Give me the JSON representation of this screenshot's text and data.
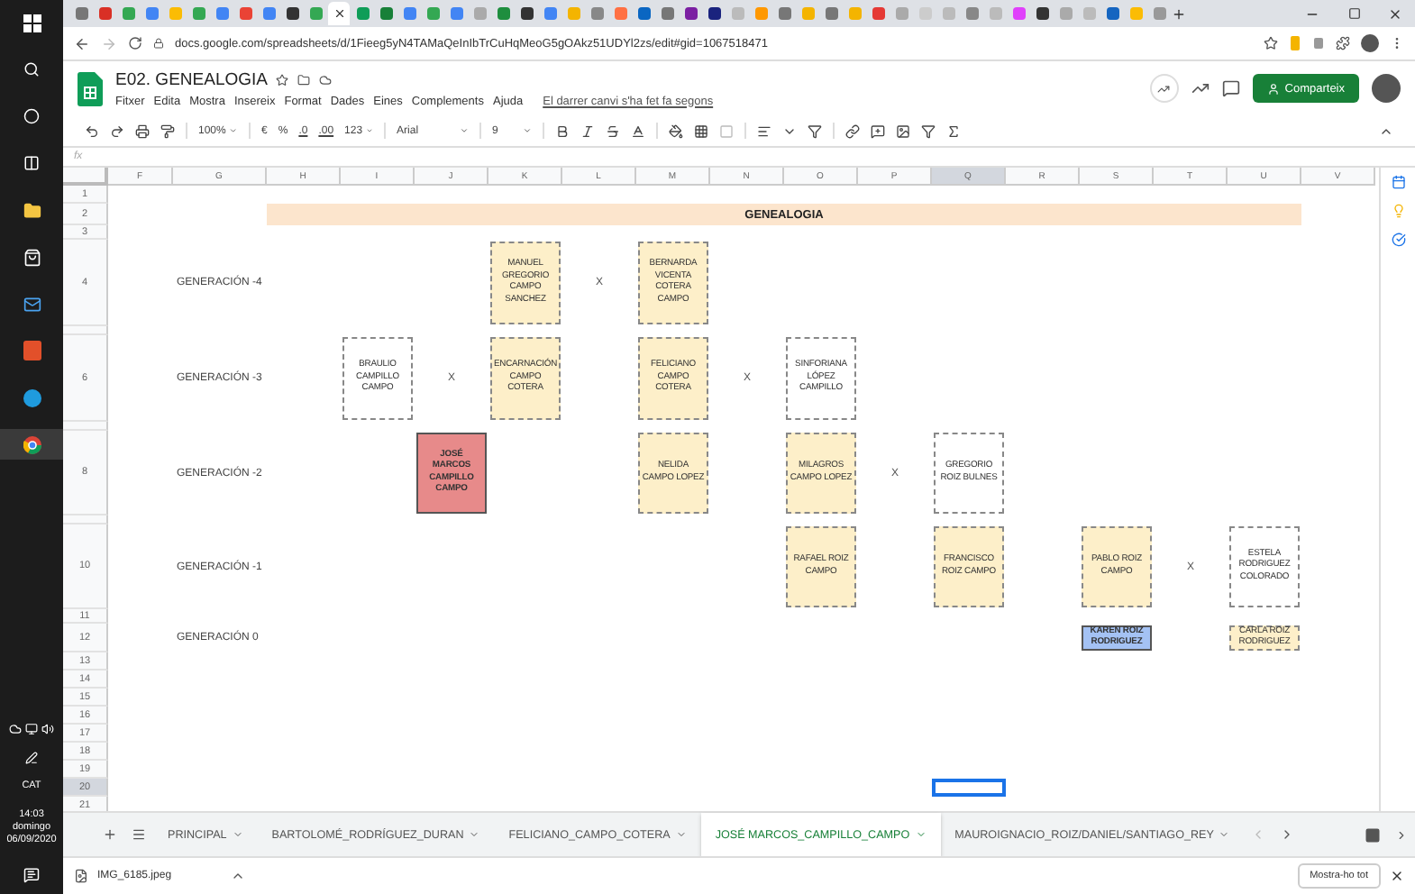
{
  "taskbar": {
    "language": "CAT",
    "time": "14:03",
    "day": "domingo",
    "date": "06/09/2020"
  },
  "browser": {
    "url": "docs.google.com/spreadsheets/d/1Fieeg5yN4TAMaQeInIbTrCuHqMeoG5gOAkz51UDYl2zs/edit#gid=1067518471"
  },
  "document": {
    "title": "E02. GENEALOGIA",
    "menus": [
      "Fitxer",
      "Edita",
      "Mostra",
      "Insereix",
      "Format",
      "Dades",
      "Eines",
      "Complements",
      "Ajuda"
    ],
    "last_edit": "El darrer canvi s'ha fet fa segons",
    "share_button": "Comparteix"
  },
  "toolbar": {
    "zoom": "100%",
    "currency": "€",
    "percent": "%",
    "decrease_decimals": ".0",
    "increase_decimals": ".00",
    "number_format": "123",
    "font": "Arial",
    "font_size": "9"
  },
  "formula_bar": {
    "label": "fx"
  },
  "sheet": {
    "columns": [
      "F",
      "G",
      "H",
      "I",
      "J",
      "K",
      "L",
      "M",
      "N",
      "O",
      "P",
      "Q",
      "R",
      "S",
      "T",
      "U",
      "V"
    ],
    "rows": [
      "1",
      "2",
      "3",
      "4",
      "6",
      "8",
      "10",
      "11",
      "12",
      "13",
      "14",
      "15",
      "16",
      "17",
      "18",
      "19",
      "20",
      "21"
    ],
    "title": "GENEALOGIA",
    "generations": [
      "GENERACIÓN -4",
      "GENERACIÓN -3",
      "GENERACIÓN -2",
      "GENERACIÓN -1",
      "GENERACIÓN 0"
    ],
    "people": [
      {
        "name": "MANUEL GREGORIO CAMPO SANCHEZ",
        "color": "#fdefc9",
        "highlighted": false
      },
      {
        "name": "BERNARDA VICENTA COTERA CAMPO",
        "color": "#fdefc9",
        "highlighted": false
      },
      {
        "name": "BRAULIO CAMPILLO CAMPO",
        "color": "#ffffff",
        "highlighted": false
      },
      {
        "name": "ENCARNACIÓN CAMPO COTERA",
        "color": "#fdefc9",
        "highlighted": false
      },
      {
        "name": "FELICIANO CAMPO COTERA",
        "color": "#fdefc9",
        "highlighted": false
      },
      {
        "name": "SINFORIANA LÓPEZ CAMPILLO",
        "color": "#ffffff",
        "highlighted": false
      },
      {
        "name": "JOSÉ MARCOS CAMPILLO CAMPO",
        "color": "#e78a8a",
        "highlighted": true
      },
      {
        "name": "NELIDA CAMPO LOPEZ",
        "color": "#fdefc9",
        "highlighted": false
      },
      {
        "name": "MILAGROS CAMPO LOPEZ",
        "color": "#fdefc9",
        "highlighted": false
      },
      {
        "name": "GREGORIO ROIZ BULNES",
        "color": "#ffffff",
        "highlighted": false
      },
      {
        "name": "RAFAEL ROIZ CAMPO",
        "color": "#fdefc9",
        "highlighted": false
      },
      {
        "name": "FRANCISCO ROIZ CAMPO",
        "color": "#fdefc9",
        "highlighted": false
      },
      {
        "name": "PABLO ROIZ CAMPO",
        "color": "#fdefc9",
        "highlighted": false
      },
      {
        "name": "ESTELA RODRIGUEZ COLORADO",
        "color": "#ffffff",
        "highlighted": false
      },
      {
        "name": "KAREN ROIZ RODRIGUEZ",
        "color": "#a4c2f4",
        "highlighted": true
      },
      {
        "name": "CARLA ROIZ RODRIGUEZ",
        "color": "#fdefc9",
        "highlighted": false
      }
    ],
    "marks": [
      "X",
      "X",
      "X",
      "X",
      "X"
    ]
  },
  "sheet_tabs": [
    {
      "label": "PRINCIPAL",
      "selected": false
    },
    {
      "label": "BARTOLOMÉ_RODRÍGUEZ_DURAN",
      "selected": false
    },
    {
      "label": "FELICIANO_CAMPO_COTERA",
      "selected": false
    },
    {
      "label": "JOSÉ MARCOS_CAMPILLO_CAMPO",
      "selected": true
    },
    {
      "label": "MAUROIGNACIO_ROIZ/DANIEL/SANTIAGO_REY",
      "selected": false
    }
  ],
  "downloads": {
    "file": "IMG_6185.jpeg",
    "show_all": "Mostra-ho tot"
  }
}
